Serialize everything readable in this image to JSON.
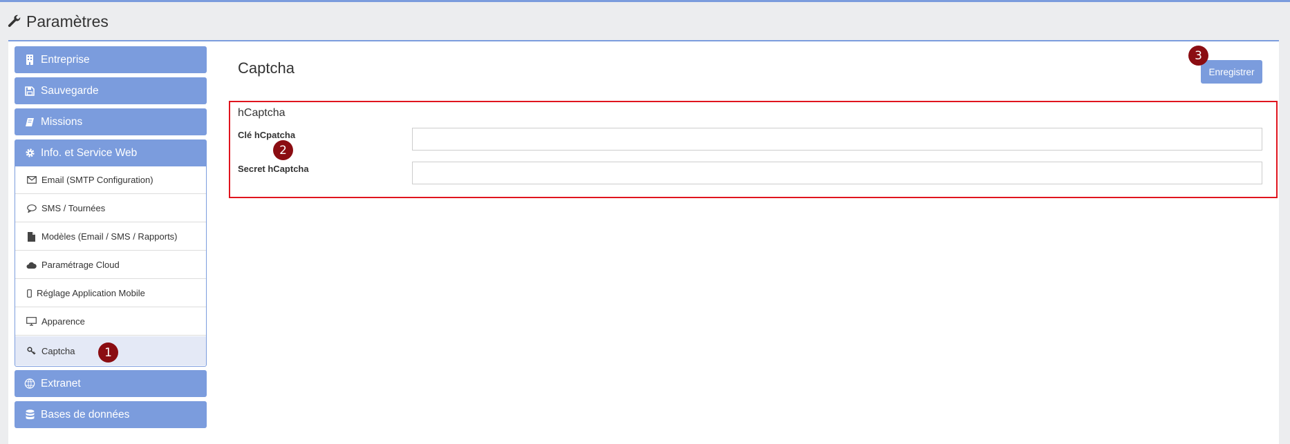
{
  "page": {
    "title": "Paramètres"
  },
  "sidebar": {
    "top_items": [
      {
        "label": "Entreprise",
        "icon": "building-icon"
      },
      {
        "label": "Sauvegarde",
        "icon": "floppy-icon"
      },
      {
        "label": "Missions",
        "icon": "book-icon"
      },
      {
        "label": "Info. et Service Web",
        "icon": "gear-icon"
      }
    ],
    "sub_items": [
      {
        "label": "Email (SMTP Configuration)",
        "icon": "envelope-icon"
      },
      {
        "label": "SMS / Tournées",
        "icon": "chat-bubble-icon"
      },
      {
        "label": "Modèles (Email / SMS / Rapports)",
        "icon": "file-icon"
      },
      {
        "label": "Paramétrage Cloud",
        "icon": "cloud-icon"
      },
      {
        "label": "Réglage Application Mobile",
        "icon": "mobile-icon"
      },
      {
        "label": "Apparence",
        "icon": "monitor-icon"
      },
      {
        "label": "Captcha",
        "icon": "key-icon"
      }
    ],
    "bottom_items": [
      {
        "label": "Extranet",
        "icon": "globe-icon"
      },
      {
        "label": "Bases de données",
        "icon": "database-icon"
      }
    ]
  },
  "main": {
    "title": "Captcha",
    "save_label": "Enregistrer",
    "section_title": "hCaptcha",
    "fields": [
      {
        "label": "Clé hCpatcha",
        "value": ""
      },
      {
        "label": "Secret hCaptcha",
        "value": ""
      }
    ]
  },
  "markers": [
    "1",
    "2",
    "3"
  ],
  "colors": {
    "accent": "#7b9cdd",
    "highlight": "#e0141e",
    "marker": "#8b0d12",
    "selected": "#e4e9f6"
  }
}
